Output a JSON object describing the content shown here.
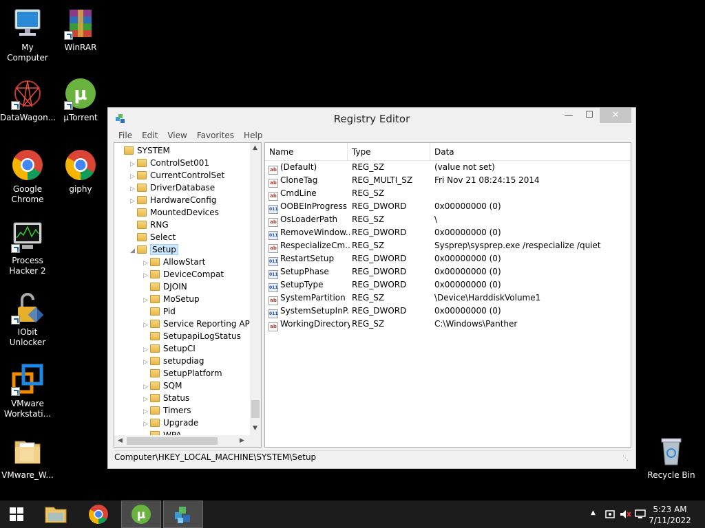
{
  "desktop": {
    "icons": [
      {
        "label": "My Computer",
        "icon": "computer-icon"
      },
      {
        "label": "WinRAR",
        "icon": "winrar-icon"
      },
      {
        "label": "DataWagon...",
        "icon": "datawagon-icon"
      },
      {
        "label": "µTorrent",
        "icon": "utorrent-icon"
      },
      {
        "label": "Google Chrome",
        "icon": "chrome-icon"
      },
      {
        "label": "giphy",
        "icon": "chrome-icon"
      },
      {
        "label": "Process Hacker 2",
        "icon": "process-hacker-icon"
      },
      {
        "label": "IObit Unlocker",
        "icon": "lock-icon"
      },
      {
        "label": "VMware Workstati...",
        "icon": "vmware-icon"
      },
      {
        "label": "VMware_W...",
        "icon": "folder-icon"
      },
      {
        "label": "Recycle Bin",
        "icon": "recycle-bin-icon"
      }
    ]
  },
  "window": {
    "title": "Registry Editor",
    "menu": [
      "File",
      "Edit",
      "View",
      "Favorites",
      "Help"
    ],
    "tree": [
      {
        "label": "SYSTEM",
        "arrow": ""
      },
      {
        "label": "ControlSet001",
        "arrow": "▷"
      },
      {
        "label": "CurrentControlSet",
        "arrow": "▷"
      },
      {
        "label": "DriverDatabase",
        "arrow": "▷"
      },
      {
        "label": "HardwareConfig",
        "arrow": "▷"
      },
      {
        "label": "MountedDevices",
        "arrow": ""
      },
      {
        "label": "RNG",
        "arrow": ""
      },
      {
        "label": "Select",
        "arrow": ""
      },
      {
        "label": "Setup",
        "arrow": "◢"
      },
      {
        "label": "AllowStart",
        "arrow": "▷"
      },
      {
        "label": "DeviceCompat",
        "arrow": "▷"
      },
      {
        "label": "DJOIN",
        "arrow": ""
      },
      {
        "label": "MoSetup",
        "arrow": "▷"
      },
      {
        "label": "Pid",
        "arrow": ""
      },
      {
        "label": "Service Reporting API",
        "arrow": "▷"
      },
      {
        "label": "SetupapiLogStatus",
        "arrow": ""
      },
      {
        "label": "SetupCI",
        "arrow": "▷"
      },
      {
        "label": "setupdiag",
        "arrow": "▷"
      },
      {
        "label": "SetupPlatform",
        "arrow": ""
      },
      {
        "label": "SQM",
        "arrow": "▷"
      },
      {
        "label": "Status",
        "arrow": "▷"
      },
      {
        "label": "Timers",
        "arrow": "▷"
      },
      {
        "label": "Upgrade",
        "arrow": "▷"
      },
      {
        "label": "WPA",
        "arrow": ""
      }
    ],
    "columns": {
      "name": "Name",
      "type": "Type",
      "data": "Data"
    },
    "values": [
      {
        "name": "(Default)",
        "type": "REG_SZ",
        "data": "(value not set)",
        "kind": "sz"
      },
      {
        "name": "CloneTag",
        "type": "REG_MULTI_SZ",
        "data": "Fri Nov 21 08:24:15 2014",
        "kind": "sz"
      },
      {
        "name": "CmdLine",
        "type": "REG_SZ",
        "data": "",
        "kind": "sz"
      },
      {
        "name": "OOBEInProgress",
        "type": "REG_DWORD",
        "data": "0x00000000 (0)",
        "kind": "bin"
      },
      {
        "name": "OsLoaderPath",
        "type": "REG_SZ",
        "data": "\\",
        "kind": "sz"
      },
      {
        "name": "RemoveWindow...",
        "type": "REG_DWORD",
        "data": "0x00000000 (0)",
        "kind": "bin"
      },
      {
        "name": "RespecializeCm...",
        "type": "REG_SZ",
        "data": "Sysprep\\sysprep.exe /respecialize /quiet",
        "kind": "sz"
      },
      {
        "name": "RestartSetup",
        "type": "REG_DWORD",
        "data": "0x00000000 (0)",
        "kind": "bin"
      },
      {
        "name": "SetupPhase",
        "type": "REG_DWORD",
        "data": "0x00000000 (0)",
        "kind": "bin"
      },
      {
        "name": "SetupType",
        "type": "REG_DWORD",
        "data": "0x00000000 (0)",
        "kind": "bin"
      },
      {
        "name": "SystemPartition",
        "type": "REG_SZ",
        "data": "\\Device\\HarddiskVolume1",
        "kind": "sz"
      },
      {
        "name": "SystemSetupInP...",
        "type": "REG_DWORD",
        "data": "0x00000000 (0)",
        "kind": "bin"
      },
      {
        "name": "WorkingDirectory",
        "type": "REG_SZ",
        "data": "C:\\Windows\\Panther",
        "kind": "sz"
      }
    ],
    "status_path": "Computer\\HKEY_LOCAL_MACHINE\\SYSTEM\\Setup"
  },
  "taskbar": {
    "items": [
      "start-button",
      "file-explorer-icon",
      "chrome-icon",
      "utorrent-icon",
      "registry-editor-icon"
    ],
    "time": "5:23 AM",
    "date": "7/11/2022"
  }
}
